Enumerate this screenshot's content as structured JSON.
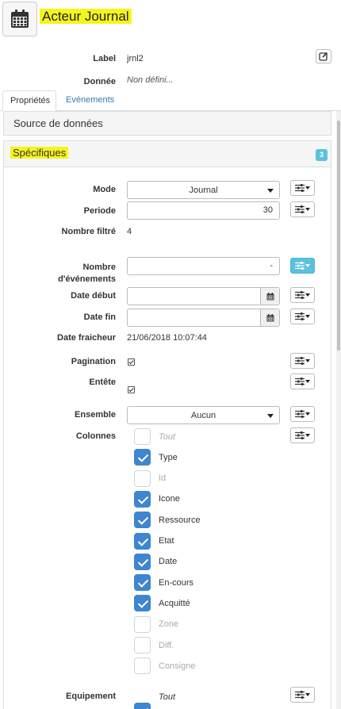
{
  "header": {
    "title": "Acteur Journal",
    "icon": "calendar-icon"
  },
  "props": {
    "label_label": "Label",
    "label_value": "jrnl2",
    "donnee_label": "Donnée",
    "donnee_value": "Non défini..."
  },
  "tabs": {
    "properties": "Propriétés",
    "events": "Evénements"
  },
  "sections": {
    "source": "Source de données",
    "specifics": "Spécifiques",
    "specifics_badge": "3"
  },
  "form": {
    "mode": {
      "label": "Mode",
      "value": "Journal"
    },
    "periode": {
      "label": "Periode",
      "value": "30"
    },
    "nombre_filtre": {
      "label": "Nombre filtré",
      "value": "4"
    },
    "nombre_evenements": {
      "label_line1": "Nombre",
      "label_line2": "d'événements",
      "value": "-"
    },
    "date_debut": {
      "label": "Date début",
      "value": ""
    },
    "date_fin": {
      "label": "Date fin",
      "value": ""
    },
    "date_fraicheur": {
      "label": "Date fraicheur",
      "value": "21/06/2018 10:07:44"
    },
    "pagination": {
      "label": "Pagination",
      "checked": true
    },
    "entete": {
      "label": "Entête",
      "checked": true
    },
    "ensemble": {
      "label": "Ensemble",
      "value": "Aucun"
    },
    "colonnes": {
      "label": "Colonnes",
      "items": [
        {
          "label": "Tout",
          "checked": false
        },
        {
          "label": "Type",
          "checked": true
        },
        {
          "label": "Id",
          "checked": false
        },
        {
          "label": "Icone",
          "checked": true
        },
        {
          "label": "Ressource",
          "checked": true
        },
        {
          "label": "Etat",
          "checked": true
        },
        {
          "label": "Date",
          "checked": true
        },
        {
          "label": "En-cours",
          "checked": true
        },
        {
          "label": "Acquitté",
          "checked": true
        },
        {
          "label": "Zone",
          "checked": false
        },
        {
          "label": "Diff.",
          "checked": false
        },
        {
          "label": "Consigne",
          "checked": false
        }
      ]
    },
    "equipement": {
      "label": "Equipement",
      "value": "Tout",
      "checked": true
    }
  },
  "colors": {
    "accent": "#3e86cf",
    "highlight": "#f5f51e",
    "info": "#5bc0de",
    "link": "#337ab7"
  }
}
